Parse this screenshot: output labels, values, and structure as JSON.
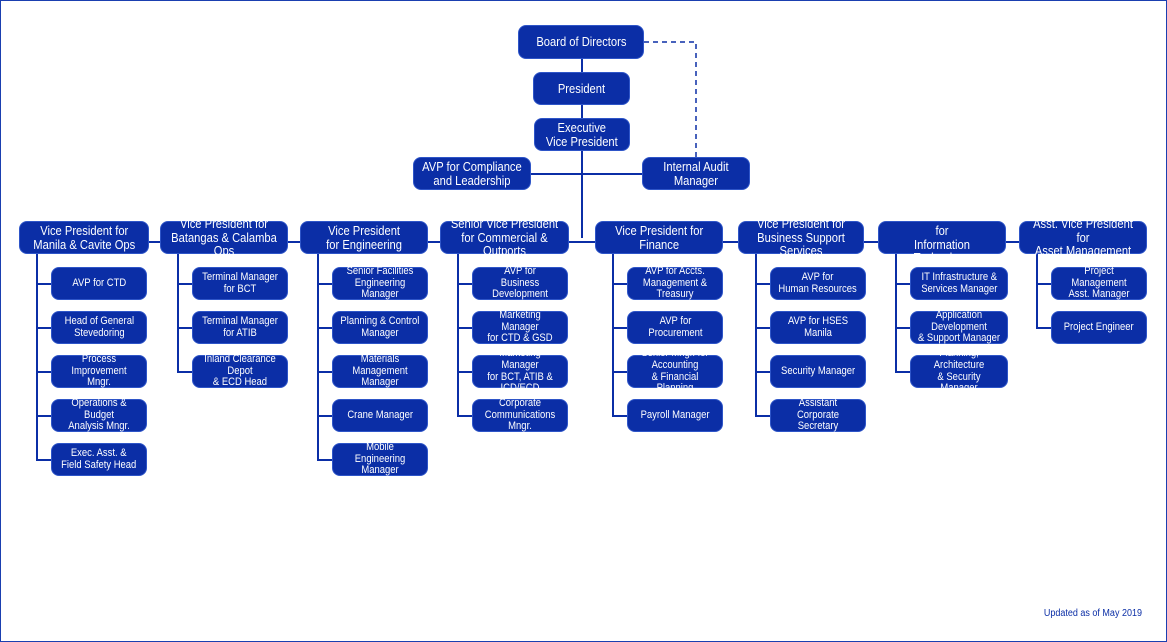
{
  "colors": {
    "box": "#0b2ea6",
    "line": "#0b2ea6"
  },
  "top": {
    "board": "Board of Directors",
    "president": "President",
    "evp": "Executive\nVice President",
    "compliance": "AVP for Compliance\nand Leadership",
    "audit": "Internal Audit\nManager"
  },
  "columns": [
    {
      "head": "Vice President for\nManila & Cavite Ops",
      "children": [
        "AVP for CTD",
        "Head of General\nStevedoring",
        "Process\nImprovement Mngr.",
        "Operations & Budget\nAnalysis Mngr.",
        "Exec. Asst. &\nField Safety Head"
      ]
    },
    {
      "head": "Vice President for\nBatangas & Calamba Ops",
      "children": [
        "Terminal Manager\nfor BCT",
        "Terminal Manager\nfor ATIB",
        "Inland Clearance Depot\n& ECD Head"
      ]
    },
    {
      "head": "Vice President\nfor Engineering",
      "children": [
        "Senior Facilities\nEngineering Manager",
        "Planning & Control\nManager",
        "Materials Management\nManager",
        "Crane Manager",
        "Mobile Engineering\nManager"
      ]
    },
    {
      "head": "Senior Vice President\nfor Commercial & Outports",
      "children": [
        "AVP for\nBusiness Development",
        "Marketing Manager\nfor CTD & GSD",
        "Marketing Manager\nfor BCT, ATIB & ICD/ECD",
        "Corporate\nCommunications Mngr."
      ]
    },
    {
      "head": "Vice President for\nFinance",
      "children": [
        "AVP for Accts.\nManagement & Treasury",
        "AVP for\nProcurement",
        "Senior Mngr. for Accounting\n& Financial Planning",
        "Payroll Manager"
      ]
    },
    {
      "head": "Vice President  for\nBusiness Support Services",
      "children": [
        "AVP for\nHuman Resources",
        "AVP for HSES Manila",
        "Security Manager",
        "Assistant\nCorporate Secretary"
      ]
    },
    {
      "head": "Asst. Vice President  for\nInformation Technology",
      "children": [
        "IT Infrastructure &\nServices Manager",
        "Application Development\n& Support Manager",
        "Planning, Architecture\n& Security Manager"
      ]
    },
    {
      "head": "Asst. Vice President  for\nAsset Management",
      "children": [
        "Project Management\nAsst. Manager",
        "Project Engineer"
      ]
    }
  ],
  "footer": "Updated as of May 2019"
}
